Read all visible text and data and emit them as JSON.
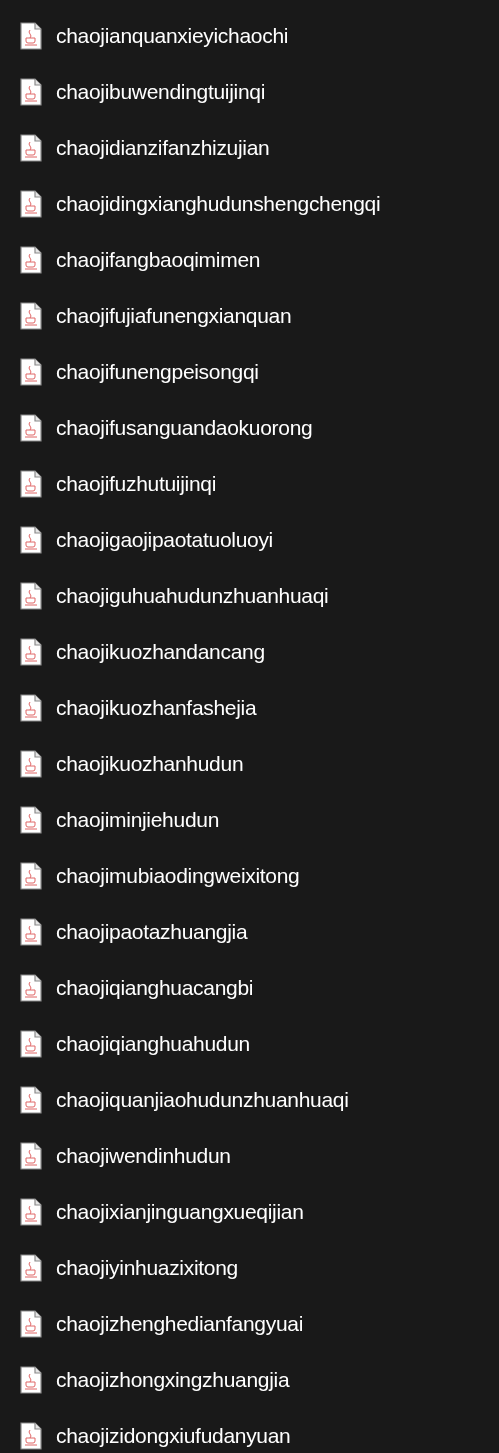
{
  "files": [
    {
      "name": "chaojianquanxieyichaochi"
    },
    {
      "name": "chaojibuwendingtuijinqi"
    },
    {
      "name": "chaojidianzifanzhizujian"
    },
    {
      "name": "chaojidingxianghudunshengchengqi"
    },
    {
      "name": "chaojifangbaoqimimen"
    },
    {
      "name": "chaojifujiafunengxianquan"
    },
    {
      "name": "chaojifunengpeisongqi"
    },
    {
      "name": "chaojifusanguandaokuorong"
    },
    {
      "name": "chaojifuzhutuijinqi"
    },
    {
      "name": "chaojigaojipaotatuoluoyi"
    },
    {
      "name": "chaojiguhuahudunzhuanhuaqi"
    },
    {
      "name": "chaojikuozhandancang"
    },
    {
      "name": "chaojikuozhanfashejia"
    },
    {
      "name": "chaojikuozhanhudun"
    },
    {
      "name": "chaojiminjiehudun"
    },
    {
      "name": "chaojimubiaodingweixitong"
    },
    {
      "name": "chaojipaotazhuangjia"
    },
    {
      "name": "chaojiqianghuacangbi"
    },
    {
      "name": "chaojiqianghuahudun"
    },
    {
      "name": "chaojiquanjiaohudunzhuanhuaqi"
    },
    {
      "name": "chaojiwendinhudun"
    },
    {
      "name": "chaojixianjinguangxueqijian"
    },
    {
      "name": "chaojiyinhuazixitong"
    },
    {
      "name": "chaojizhenghedianfangyuai"
    },
    {
      "name": "chaojizhongxingzhuangjia"
    },
    {
      "name": "chaojizidongxiufudanyuan"
    }
  ]
}
